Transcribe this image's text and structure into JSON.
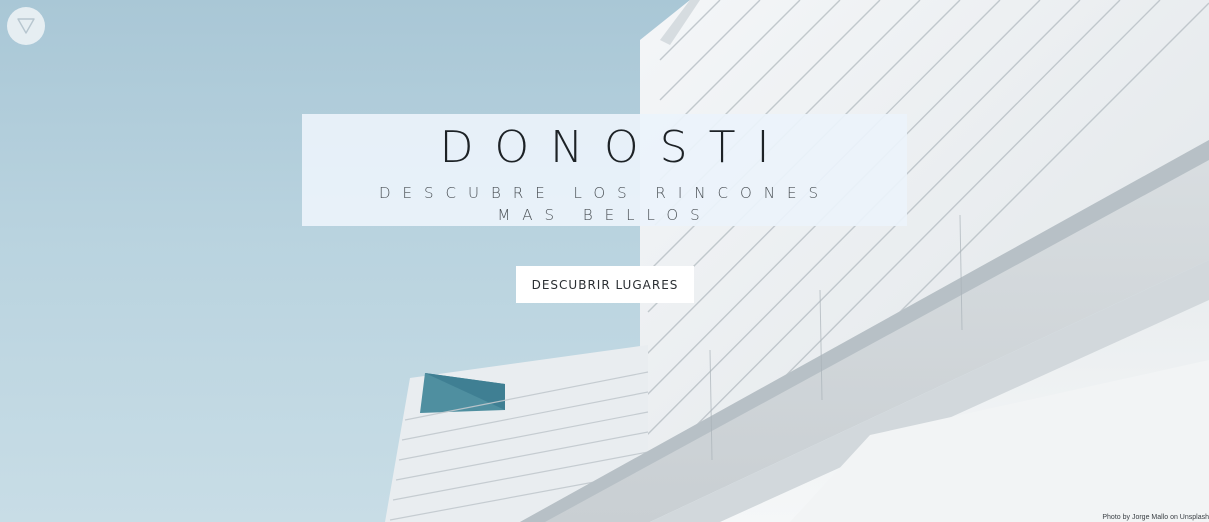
{
  "hero": {
    "title": "DONOSTI",
    "subtitle": "DESCUBRE LOS RINCONES MAS BELLOS",
    "cta_label": "DESCUBRIR LUGARES",
    "photo_credit": "Photo by Jorge Mallo on Unsplash"
  },
  "menu": {
    "icon": "triangle-down-icon"
  },
  "colors": {
    "sky": "#b6d0dc",
    "building": "#eef1f3",
    "title_box": "#ecf3fb",
    "text_dark": "#1d2226",
    "button_bg": "#ffffff"
  }
}
